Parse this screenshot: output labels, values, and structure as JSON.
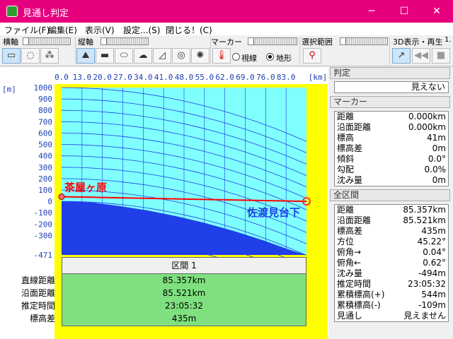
{
  "window": {
    "title": "見通し判定",
    "min": "─",
    "max": "☐",
    "close": "✕"
  },
  "menu": [
    "ファイル(F)",
    "編集(E)",
    "表示(V)",
    "設定...(S)",
    "閉じる！(C)"
  ],
  "toolbar": {
    "yoko_label": "横軸",
    "tate_label": "縦軸",
    "marker_label": "マーカー",
    "range_label": "選択範囲",
    "display3d_label": "3D表示・再生",
    "radio_line": "視線",
    "radio_terrain": "地形",
    "selected_radio": "地形",
    "page_num": "1."
  },
  "chart_data": {
    "type": "line",
    "x_ticks": [
      "0.0",
      "13.0",
      "20.0",
      "27.0",
      "34.0",
      "41.0",
      "48.0",
      "55.0",
      "62.0",
      "69.0",
      "76.0",
      "83.0"
    ],
    "x_unit": "[km]",
    "y_unit": "[m]",
    "y_ticks": [
      "1000",
      "900",
      "800",
      "700",
      "600",
      "500",
      "400",
      "300",
      "200",
      "100",
      "0",
      "-100",
      "-200",
      "-300",
      "-471"
    ],
    "ylim": [
      -471,
      1000
    ],
    "xlim": [
      0,
      85.357
    ],
    "start_label": "茶屋ヶ原",
    "end_label": "佐渡見台下",
    "sightline": {
      "x": [
        0,
        85.357
      ],
      "y": [
        41,
        0
      ]
    },
    "terrain_top": {
      "x": [
        0,
        10,
        20,
        30,
        40,
        50,
        60,
        70,
        80,
        85.357
      ],
      "y": [
        0,
        -8,
        -40,
        -80,
        -130,
        -190,
        -260,
        -340,
        -430,
        -471
      ]
    },
    "colors": {
      "sky": "#80ffff",
      "earth": "#1f3fe8",
      "frame": "#ffff00",
      "line": "#ff0000",
      "grid": "#1f3fe8"
    }
  },
  "section": {
    "header": "区間 1",
    "labels": [
      "直線距離",
      "沿面距離",
      "推定時間",
      "標高差"
    ],
    "values": [
      "85.357km",
      "85.521km",
      "23:05:32",
      "435m"
    ]
  },
  "right": {
    "judge_title": "判定",
    "judge_value": "見えない",
    "marker_title": "マーカー",
    "marker_rows": [
      [
        "距離",
        "0.000km"
      ],
      [
        "沿面距離",
        "0.000km"
      ],
      [
        "標高",
        "41m"
      ],
      [
        "標高差",
        "0m"
      ],
      [
        "傾斜",
        "0.0°"
      ],
      [
        "勾配",
        "0.0%"
      ],
      [
        "沈み量",
        "0m"
      ]
    ],
    "all_title": "全区間",
    "all_rows": [
      [
        "距離",
        "85.357km"
      ],
      [
        "沿面距離",
        "85.521km"
      ],
      [
        "標高差",
        "435m"
      ],
      [
        "方位",
        "45.22°"
      ],
      [
        "俯角→",
        "0.04°"
      ],
      [
        "俯角←",
        "0.62°"
      ],
      [
        "沈み量",
        "-494m"
      ],
      [
        "推定時間",
        "23:05:32"
      ],
      [
        "累積標高(+)",
        "544m"
      ],
      [
        "累積標高(-)",
        "-109m"
      ],
      [
        "見通し",
        "見えません"
      ]
    ]
  }
}
